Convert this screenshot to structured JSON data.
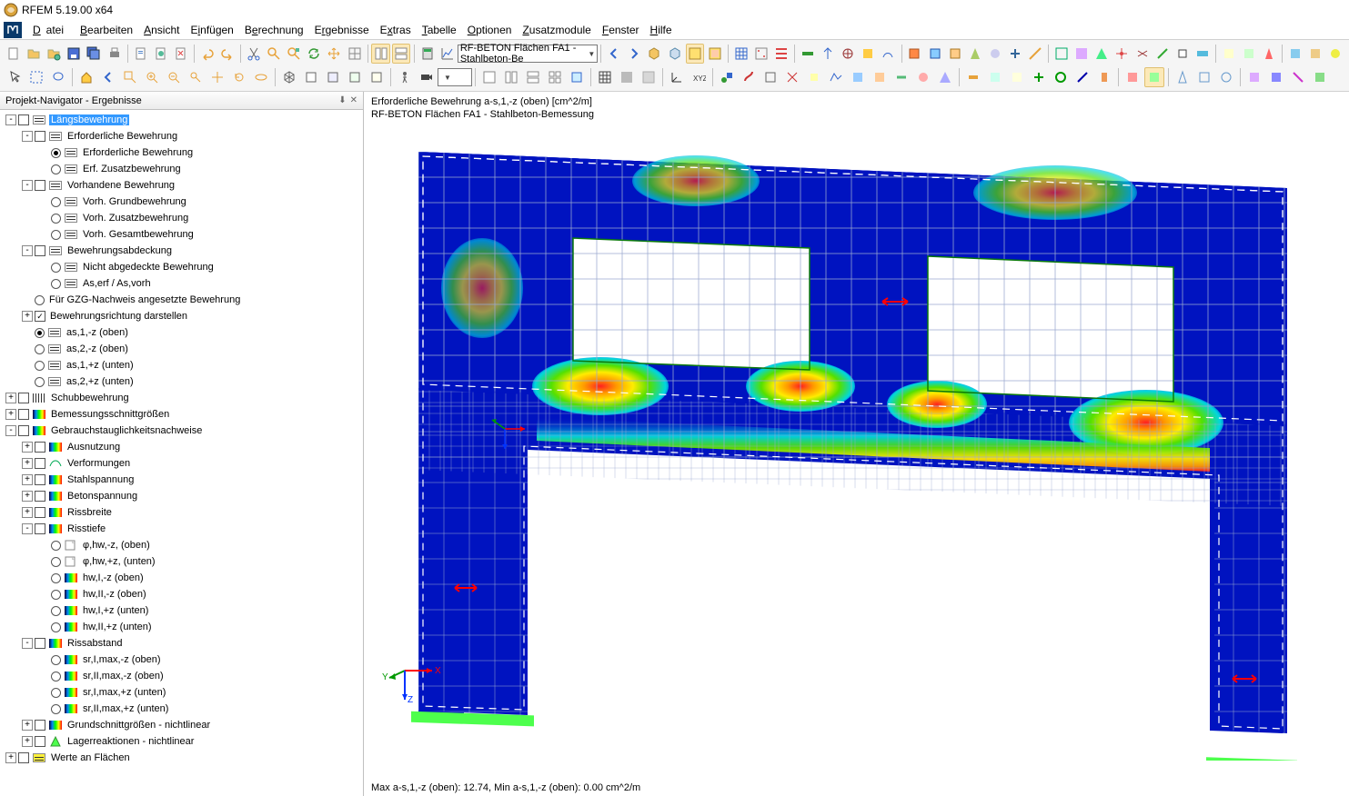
{
  "app": {
    "title": "RFEM 5.19.00 x64"
  },
  "menu": [
    "Datei",
    "Bearbeiten",
    "Ansicht",
    "Einfügen",
    "Berechnung",
    "Ergebnisse",
    "Extras",
    "Tabelle",
    "Optionen",
    "Zusatzmodule",
    "Fenster",
    "Hilfe"
  ],
  "toolbar": {
    "combo": "RF-BETON Flächen FA1 - Stahlbeton-Be"
  },
  "navigator": {
    "title": "Projekt-Navigator - Ergebnisse",
    "items": [
      {
        "d": 0,
        "tw": "-",
        "chk": true,
        "ic": "bars",
        "lbl": "Längsbewehrung",
        "sel": true
      },
      {
        "d": 1,
        "tw": "-",
        "chk": true,
        "ic": "bars",
        "lbl": "Erforderliche Bewehrung"
      },
      {
        "d": 2,
        "radio": "on",
        "ic": "bars",
        "lbl": "Erforderliche Bewehrung"
      },
      {
        "d": 2,
        "radio": "off",
        "ic": "bars",
        "lbl": "Erf. Zusatzbewehrung"
      },
      {
        "d": 1,
        "tw": "-",
        "chk": true,
        "ic": "bars",
        "lbl": "Vorhandene Bewehrung"
      },
      {
        "d": 2,
        "radio": "off",
        "ic": "bars",
        "lbl": "Vorh. Grundbewehrung"
      },
      {
        "d": 2,
        "radio": "off",
        "ic": "bars",
        "lbl": "Vorh. Zusatzbewehrung"
      },
      {
        "d": 2,
        "radio": "off",
        "ic": "bars",
        "lbl": "Vorh. Gesamtbewehrung"
      },
      {
        "d": 1,
        "tw": "-",
        "chk": true,
        "ic": "bars",
        "lbl": "Bewehrungsabdeckung"
      },
      {
        "d": 2,
        "radio": "off",
        "ic": "bars",
        "lbl": "Nicht abgedeckte Bewehrung"
      },
      {
        "d": 2,
        "radio": "off",
        "ic": "bars",
        "lbl": "As,erf / As,vorh",
        "sub": true
      },
      {
        "d": 1,
        "radio": "off",
        "lbl": "Für GZG-Nachweis angesetzte Bewehrung"
      },
      {
        "d": 1,
        "tw": "+",
        "chk": "check",
        "lbl": "Bewehrungsrichtung darstellen"
      },
      {
        "d": 1,
        "radio": "on",
        "ic": "bars",
        "lbl": "as,1,-z (oben)",
        "sub": true
      },
      {
        "d": 1,
        "radio": "off",
        "ic": "bars",
        "lbl": "as,2,-z (oben)",
        "sub": true
      },
      {
        "d": 1,
        "radio": "off",
        "ic": "bars",
        "lbl": "as,1,+z (unten)",
        "sub": true
      },
      {
        "d": 1,
        "radio": "off",
        "ic": "bars",
        "lbl": "as,2,+z (unten)",
        "sub": true
      },
      {
        "d": 0,
        "tw": "+",
        "chk": true,
        "ic": "hatch",
        "lbl": "Schubbewehrung"
      },
      {
        "d": 0,
        "tw": "+",
        "chk": true,
        "ic": "grad",
        "lbl": "Bemessungsschnittgrößen"
      },
      {
        "d": 0,
        "tw": "-",
        "chk": true,
        "ic": "grad",
        "lbl": "Gebrauchstauglichkeitsnachweise"
      },
      {
        "d": 1,
        "tw": "+",
        "chk": true,
        "ic": "grad",
        "lbl": "Ausnutzung"
      },
      {
        "d": 1,
        "tw": "+",
        "chk": true,
        "ic": "curve",
        "lbl": "Verformungen"
      },
      {
        "d": 1,
        "tw": "+",
        "chk": true,
        "ic": "grad",
        "lbl": "Stahlspannung"
      },
      {
        "d": 1,
        "tw": "+",
        "chk": true,
        "ic": "grad",
        "lbl": "Betonspannung"
      },
      {
        "d": 1,
        "tw": "+",
        "chk": true,
        "ic": "grad",
        "lbl": "Rissbreite"
      },
      {
        "d": 1,
        "tw": "-",
        "chk": true,
        "ic": "grad",
        "lbl": "Risstiefe"
      },
      {
        "d": 2,
        "radio": "off",
        "ic": "note",
        "lbl": "φ,hw,-z, (oben)",
        "sub": true
      },
      {
        "d": 2,
        "radio": "off",
        "ic": "note",
        "lbl": "φ,hw,+z, (unten)",
        "sub": true
      },
      {
        "d": 2,
        "radio": "off",
        "ic": "grad",
        "lbl": "hw,I,-z (oben)",
        "sub": true
      },
      {
        "d": 2,
        "radio": "off",
        "ic": "grad",
        "lbl": "hw,II,-z (oben)",
        "sub": true
      },
      {
        "d": 2,
        "radio": "off",
        "ic": "grad",
        "lbl": "hw,I,+z (unten)",
        "sub": true
      },
      {
        "d": 2,
        "radio": "off",
        "ic": "grad",
        "lbl": "hw,II,+z (unten)",
        "sub": true
      },
      {
        "d": 1,
        "tw": "-",
        "chk": true,
        "ic": "grad",
        "lbl": "Rissabstand"
      },
      {
        "d": 2,
        "radio": "off",
        "ic": "grad",
        "lbl": "sr,I,max,-z (oben)",
        "sub": true
      },
      {
        "d": 2,
        "radio": "off",
        "ic": "grad",
        "lbl": "sr,II,max,-z (oben)",
        "sub": true
      },
      {
        "d": 2,
        "radio": "off",
        "ic": "grad",
        "lbl": "sr,I,max,+z (unten)",
        "sub": true
      },
      {
        "d": 2,
        "radio": "off",
        "ic": "grad",
        "lbl": "sr,II,max,+z (unten)",
        "sub": true
      },
      {
        "d": 1,
        "tw": "+",
        "chk": true,
        "ic": "grad",
        "lbl": "Grundschnittgrößen - nichtlinear"
      },
      {
        "d": 1,
        "tw": "+",
        "chk": true,
        "ic": "tri",
        "lbl": "Lagerreaktionen - nichtlinear"
      },
      {
        "d": 0,
        "tw": "+",
        "chk": true,
        "ic": "yellow",
        "lbl": "Werte an Flächen"
      }
    ]
  },
  "viewport": {
    "line1": "Erforderliche Bewehrung a-s,1,-z (oben) [cm^2/m]",
    "line2": "RF-BETON Flächen FA1 - Stahlbeton-Bemessung",
    "footer": "Max a-s,1,-z (oben): 12.74, Min a-s,1,-z (oben): 0.00 cm^2/m",
    "axes": {
      "x": "X",
      "y": "Y",
      "z": "Z"
    }
  }
}
